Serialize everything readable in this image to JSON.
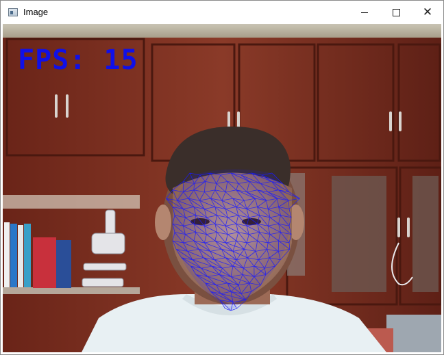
{
  "window": {
    "title": "Image",
    "icon": "image-window-icon"
  },
  "controls": {
    "minimize": "minimize-icon",
    "maximize": "maximize-icon",
    "close": "close-icon"
  },
  "overlay": {
    "fps_text": "FPS: 15",
    "fps_color": "#1010e8"
  },
  "colors": {
    "mesh": "#1a1aff",
    "wall": "#7a2e20",
    "shirt": "#e9f2f5"
  }
}
